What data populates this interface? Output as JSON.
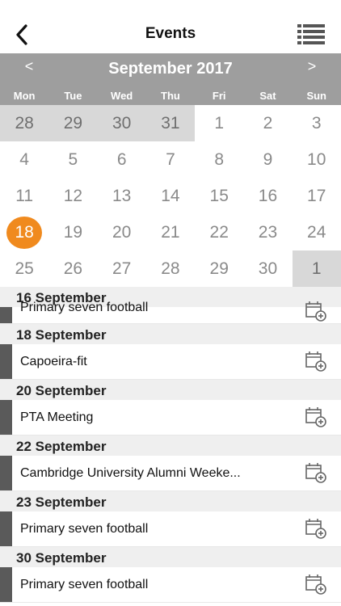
{
  "header": {
    "title": "Events"
  },
  "calendar": {
    "month_title": "September 2017",
    "prev": "<",
    "next": ">",
    "weekdays": [
      "Mon",
      "Tue",
      "Wed",
      "Thu",
      "Fri",
      "Sat",
      "Sun"
    ],
    "weeks": [
      [
        "28",
        "29",
        "30",
        "31",
        "1",
        "2",
        "3"
      ],
      [
        "4",
        "5",
        "6",
        "7",
        "8",
        "9",
        "10"
      ],
      [
        "11",
        "12",
        "13",
        "14",
        "15",
        "16",
        "17"
      ],
      [
        "18",
        "19",
        "20",
        "21",
        "22",
        "23",
        "24"
      ],
      [
        "25",
        "26",
        "27",
        "28",
        "29",
        "30",
        "1"
      ]
    ],
    "today": "18",
    "today_color": "#f08a1e"
  },
  "events": [
    {
      "date": "16 September",
      "items": [
        {
          "title": "Primary seven football"
        }
      ]
    },
    {
      "date": "18 September",
      "items": [
        {
          "title": "Capoeira-fit"
        }
      ]
    },
    {
      "date": "20 September",
      "items": [
        {
          "title": "PTA Meeting"
        }
      ]
    },
    {
      "date": "22 September",
      "items": [
        {
          "title": "Cambridge University Alumni Weeke..."
        }
      ]
    },
    {
      "date": "23 September",
      "items": [
        {
          "title": "Primary seven football"
        }
      ]
    },
    {
      "date": "30 September",
      "items": [
        {
          "title": "Primary seven football"
        }
      ]
    }
  ],
  "icons": {
    "back": "chevron-left-icon",
    "list": "list-icon",
    "add_event": "calendar-add-icon"
  }
}
